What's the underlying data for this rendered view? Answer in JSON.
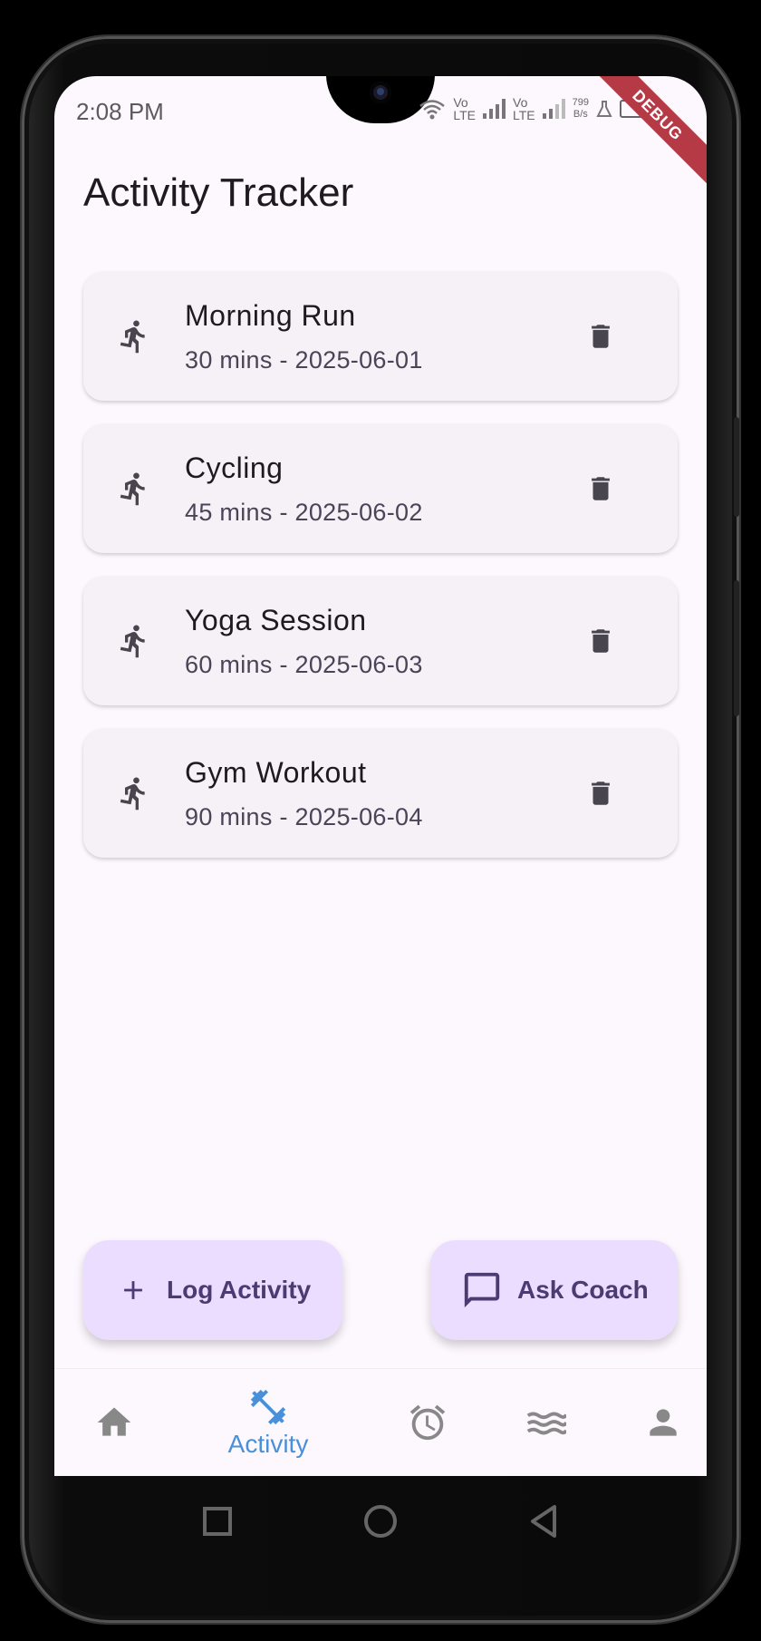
{
  "status_bar": {
    "time": "2:08 PM",
    "sim1_top": "Vo",
    "sim1_bottom": "LTE",
    "sim2_top": "Vo",
    "sim2_bottom": "LTE",
    "speed_value": "799",
    "speed_unit": "B/s",
    "debug_banner": "DEBUG"
  },
  "app": {
    "title": "Activity Tracker"
  },
  "activities": [
    {
      "name": "Morning Run",
      "detail": "30 mins - 2025-06-01",
      "icon": "run-icon"
    },
    {
      "name": "Cycling",
      "detail": "45 mins - 2025-06-02",
      "icon": "run-icon"
    },
    {
      "name": "Yoga Session",
      "detail": "60 mins - 2025-06-03",
      "icon": "run-icon"
    },
    {
      "name": "Gym Workout",
      "detail": "90 mins - 2025-06-04",
      "icon": "run-icon"
    }
  ],
  "actions": {
    "log_activity": "Log Activity",
    "ask_coach": "Ask Coach"
  },
  "bottom_nav": {
    "items": [
      {
        "icon": "home-icon",
        "label": ""
      },
      {
        "icon": "fitness-icon",
        "label": "Activity",
        "selected": true
      },
      {
        "icon": "alarm-icon",
        "label": ""
      },
      {
        "icon": "waves-icon",
        "label": ""
      },
      {
        "icon": "person-icon",
        "label": ""
      }
    ]
  },
  "colors": {
    "background": "#fdf7fe",
    "card": "#f5f1f6",
    "fab": "#eaddff",
    "fab_text": "#4a3b72",
    "nav_selected": "#4a90d9",
    "nav_unselected": "#888888",
    "debug_banner": "#b53a45"
  }
}
